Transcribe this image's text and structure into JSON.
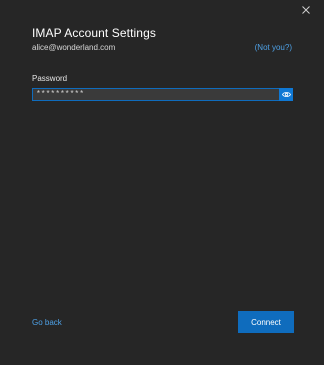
{
  "dialog": {
    "title": "IMAP Account Settings",
    "email": "alice@wonderland.com",
    "not_you_label": "(Not you?)"
  },
  "password": {
    "label": "Password",
    "value": "**********",
    "reveal_icon": "eye-icon"
  },
  "footer": {
    "go_back_label": "Go back",
    "connect_label": "Connect"
  },
  "colors": {
    "background": "#262626",
    "accent": "#0f6cbd",
    "link": "#4ea1e6"
  }
}
